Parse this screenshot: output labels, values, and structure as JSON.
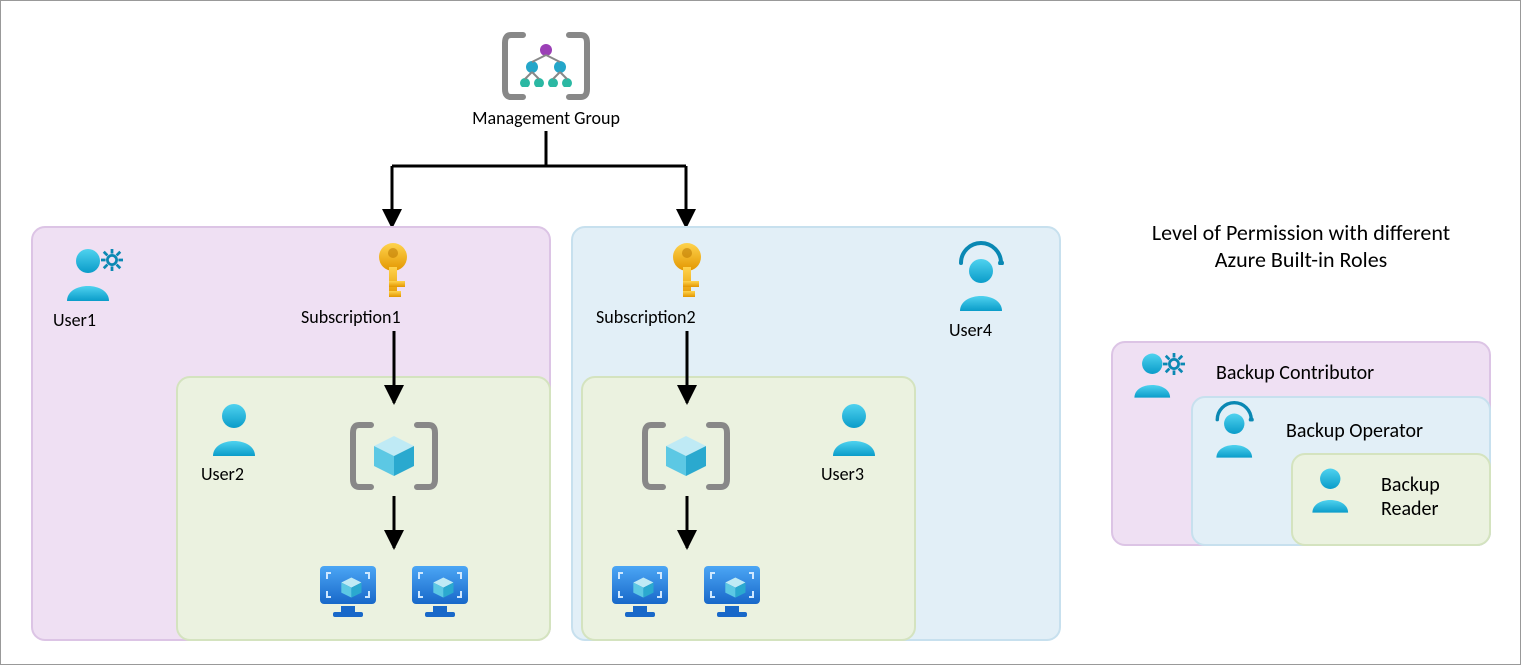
{
  "top": {
    "management_group": "Management Group"
  },
  "sub1": {
    "label": "Subscription1"
  },
  "sub2": {
    "label": "Subscription2"
  },
  "users": {
    "u1": "User1",
    "u2": "User2",
    "u3": "User3",
    "u4": "User4"
  },
  "legend": {
    "title": "Level of Permission with different Azure Built-in Roles",
    "contributor": "Backup Contributor",
    "operator": "Backup Operator",
    "reader_l1": "Backup",
    "reader_l2": "Reader"
  },
  "colors": {
    "purple": "#efe0f3",
    "blue": "#e2eff7",
    "green": "#ebf2e0",
    "user": "#1ab6e0",
    "user_dark": "#0a88b3",
    "key_gold": "#f8b400",
    "key_dark": "#d28a00",
    "cube_light": "#aee6f2",
    "cube_dark": "#3eb6d8",
    "monitor": "#2a7de1",
    "bracket": "#888888"
  }
}
